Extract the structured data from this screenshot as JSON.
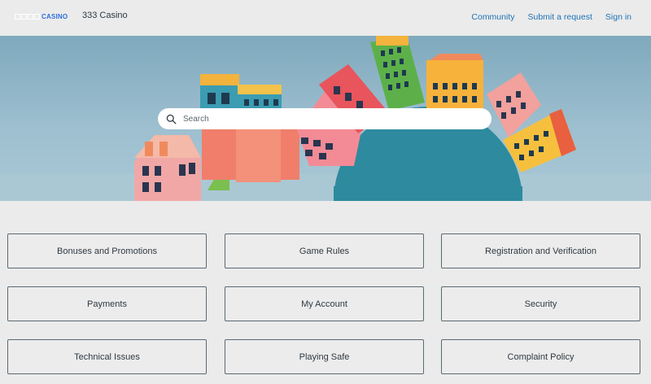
{
  "header": {
    "logo_text": "CASINO",
    "site_name": "333 Casino",
    "nav": [
      "Community",
      "Submit a request",
      "Sign in"
    ]
  },
  "search": {
    "placeholder": "Search",
    "icon": "search-icon"
  },
  "categories": [
    "Bonuses and Promotions",
    "Game Rules",
    "Registration and Verification",
    "Payments",
    "My Account",
    "Security",
    "Technical Issues",
    "Playing Safe",
    "Complaint Policy"
  ],
  "colors": {
    "link": "#1f73b7",
    "background": "#ebebeb",
    "card_border": "#5a6a72"
  }
}
